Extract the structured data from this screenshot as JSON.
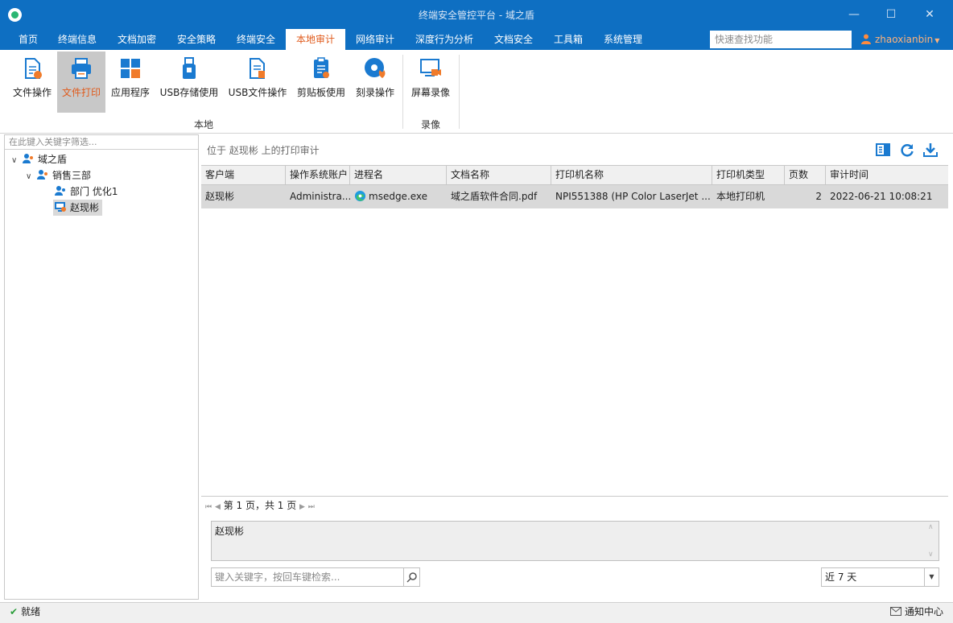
{
  "window": {
    "title": "终端安全管控平台 - 域之盾"
  },
  "menu": {
    "items": [
      {
        "label": "首页"
      },
      {
        "label": "终端信息"
      },
      {
        "label": "文档加密"
      },
      {
        "label": "安全策略"
      },
      {
        "label": "终端安全"
      },
      {
        "label": "本地审计"
      },
      {
        "label": "网络审计"
      },
      {
        "label": "深度行为分析"
      },
      {
        "label": "文档安全"
      },
      {
        "label": "工具箱"
      },
      {
        "label": "系统管理"
      }
    ],
    "active_index": 5,
    "quick_search_placeholder": "快速查找功能",
    "user": "zhaoxianbin"
  },
  "ribbon": {
    "buttons": [
      {
        "label": "文件操作",
        "icon": "file-operation-icon"
      },
      {
        "label": "文件打印",
        "icon": "printer-icon"
      },
      {
        "label": "应用程序",
        "icon": "apps-icon"
      },
      {
        "label": "USB存储使用",
        "icon": "usb-storage-icon"
      },
      {
        "label": "USB文件操作",
        "icon": "usb-file-icon"
      },
      {
        "label": "剪贴板使用",
        "icon": "clipboard-icon"
      },
      {
        "label": "刻录操作",
        "icon": "disc-burn-icon"
      },
      {
        "label": "屏幕录像",
        "icon": "screen-record-icon"
      }
    ],
    "groups": [
      {
        "label": "本地"
      },
      {
        "label": "录像"
      }
    ]
  },
  "tree": {
    "filter_placeholder": "在此键入关键字筛选...",
    "nodes": [
      {
        "label": "域之盾"
      },
      {
        "label": "销售三部"
      },
      {
        "label": "部门 优化1"
      },
      {
        "label": "赵现彬"
      }
    ]
  },
  "main": {
    "path_info": "位于 赵现彬 上的打印审计",
    "columns": [
      "客户端",
      "操作系统账户",
      "进程名",
      "文档名称",
      "打印机名称",
      "打印机类型",
      "页数",
      "审计时间"
    ],
    "rows": [
      {
        "client": "赵现彬",
        "os_account": "Administra...",
        "process": "msedge.exe",
        "doc_name": "域之盾软件合同.pdf",
        "printer_name": "NPI551388 (HP Color LaserJet ...",
        "printer_type": "本地打印机",
        "pages": "2",
        "audit_time": "2022-06-21 10:08:21"
      }
    ],
    "pager": "第 1 页，共 1 页",
    "detail_text": "赵现彬",
    "keyword_placeholder": "键入关键字，按回车键检索...",
    "date_range": "近 7 天"
  },
  "status": {
    "ready": "就绪",
    "notify": "通知中心"
  },
  "colors": {
    "accent": "#0e6fc2",
    "active_text": "#e05a1b",
    "selection": "#d9d9d9"
  }
}
